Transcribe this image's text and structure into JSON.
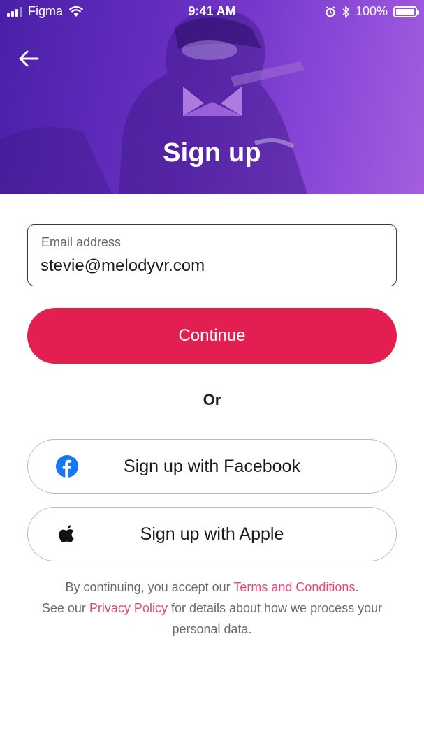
{
  "status_bar": {
    "carrier": "Figma",
    "time": "9:41 AM",
    "battery": "100%"
  },
  "header": {
    "title": "Sign up"
  },
  "icons": {
    "back": "arrow-left-icon",
    "logo": "melodyvr-logo",
    "facebook": "facebook-icon",
    "apple": "apple-icon"
  },
  "form": {
    "email_label": "Email address",
    "email_value": "stevie@melodyvr.com",
    "continue_label": "Continue"
  },
  "divider_text": "Or",
  "social": {
    "facebook_label": "Sign up with Facebook",
    "apple_label": "Sign up with Apple"
  },
  "legal": {
    "line1_prefix": "By continuing, you accept our ",
    "terms_link": "Terms and Conditions",
    "line1_suffix": ".",
    "line2_prefix": "See our ",
    "privacy_link": "Privacy Policy",
    "line2_suffix": " for details about how we process your personal data."
  },
  "colors": {
    "accent": "#e31e51",
    "link": "#e8467a",
    "hero_purple": "#6b30c4",
    "facebook_blue": "#1877f2"
  }
}
